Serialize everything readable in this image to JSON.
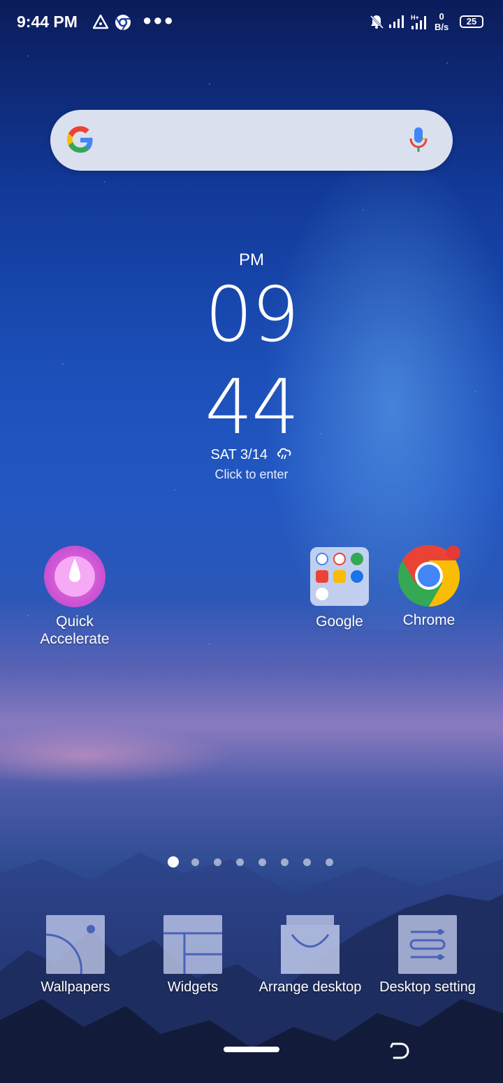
{
  "status_bar": {
    "time": "9:44 PM",
    "net_speed_value": "0",
    "net_speed_unit": "B/s",
    "battery": "25",
    "icons": [
      "vpn-triangle-icon",
      "chrome-notification-icon",
      "more-dots-icon",
      "notifications-muted-icon",
      "signal-icon",
      "hplus-signal-icon",
      "battery-icon"
    ]
  },
  "search": {
    "placeholder": "",
    "icons": [
      "google-logo-icon",
      "microphone-icon"
    ]
  },
  "clock": {
    "ampm": "PM",
    "hour": "09",
    "minute": "44",
    "date": "SAT  3/14",
    "hint": "Click to enter"
  },
  "apps": [
    {
      "label_line1": "Quick",
      "label_line2": "Accelerate"
    },
    {
      "label": "Google"
    },
    {
      "label": "Chrome"
    }
  ],
  "pager": {
    "pages": 8,
    "current": 0
  },
  "toolbar": [
    {
      "label": "Wallpapers"
    },
    {
      "label": "Widgets"
    },
    {
      "label": "Arrange desktop"
    },
    {
      "label": "Desktop setting"
    }
  ],
  "colors": {
    "google_blue": "#4285F4",
    "google_red": "#EA4335",
    "google_yellow": "#FBBC05",
    "google_green": "#34A853",
    "notification_dot": "#E53935"
  }
}
